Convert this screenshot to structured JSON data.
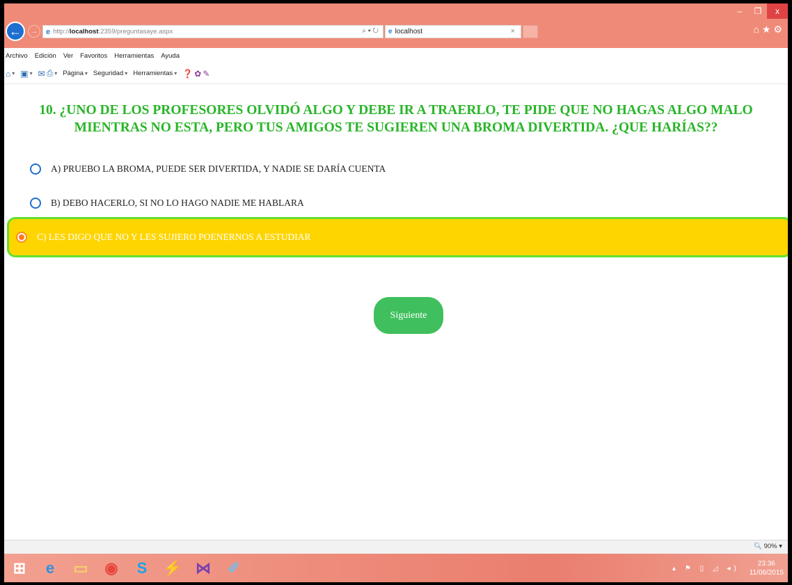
{
  "browser": {
    "window_controls": {
      "minimize": "–",
      "restore": "❐",
      "close": "x"
    },
    "url_scheme": "http://",
    "url_host": "localhost",
    "url_rest": ":2359/preguntasaye.aspx",
    "address_tools": "⌕ ▾ ↻",
    "tab_title": "localhost",
    "tab_close": "×",
    "right_icons": "⌂★⚙"
  },
  "menu": {
    "items": [
      "Archivo",
      "Edición",
      "Ver",
      "Favoritos",
      "Herramientas",
      "Ayuda"
    ]
  },
  "command_bar": {
    "pagina": "Página",
    "seguridad": "Seguridad",
    "herramientas": "Herramientas"
  },
  "page": {
    "question": "10. ¿UNO DE LOS PROFESORES OLVIDÓ ALGO Y DEBE IR A TRAERLO, TE PIDE QUE NO HAGAS ALGO MALO MIENTRAS NO ESTA, PERO TUS AMIGOS TE SUGIEREN UNA BROMA DIVERTIDA. ¿QUE HARÍAS??",
    "options": [
      {
        "label": "A) PRUEBO LA BROMA, PUEDE SER DIVERTIDA, Y NADIE SE DARÍA CUENTA",
        "selected": false
      },
      {
        "label": "B) DEBO HACERLO, SI NO LO HAGO NADIE ME HABLARA",
        "selected": false
      },
      {
        "label": "C) LES DIGO QUE NO Y LES SUJIERO POENERNOS A ESTUDIAR",
        "selected": true
      }
    ],
    "next_button": "Siguiente"
  },
  "status": {
    "zoom": "90%"
  },
  "taskbar": {
    "clock_time": "23:36",
    "clock_date": "11/06/2015"
  },
  "colors": {
    "chrome": "#f08a78",
    "question_text": "#28b528",
    "selected_bg": "#ffd500",
    "selected_border": "#63e02c",
    "button_bg": "#3fbf5d"
  }
}
